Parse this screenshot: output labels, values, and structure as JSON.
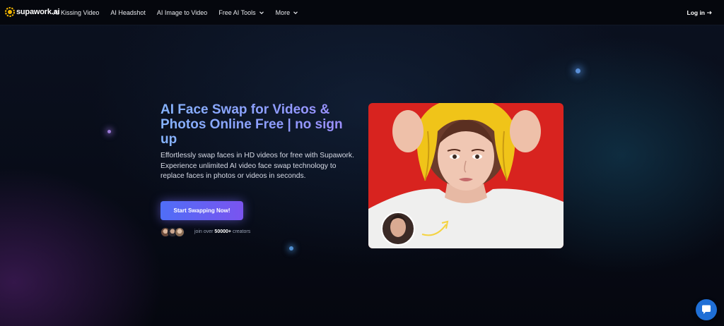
{
  "brand": {
    "name": "supawork.ai",
    "logo_icon": "gear-icon"
  },
  "nav": {
    "items": [
      {
        "label": "AI Kissing Video",
        "has_dropdown": false
      },
      {
        "label": "AI Headshot",
        "has_dropdown": false
      },
      {
        "label": "AI Image to Video",
        "has_dropdown": false
      },
      {
        "label": "Free AI Tools",
        "has_dropdown": true
      },
      {
        "label": "More",
        "has_dropdown": true
      }
    ],
    "login_label": "Log in"
  },
  "hero": {
    "title": "AI Face Swap for Videos & Photos Online Free | no sign up",
    "description": "Effortlessly swap faces in HD videos for free with Supawork. Experience unlimited AI video face swap technology to replace faces in photos or videos in seconds.",
    "cta_label": "Start Swapping Now!",
    "social_proof": {
      "prefix": "join over",
      "count": "50000+",
      "suffix": "creators"
    }
  },
  "colors": {
    "accent_gradient_start": "#4f6ef7",
    "accent_gradient_end": "#7a54ef",
    "title_color": "#86b4ff",
    "chat_button": "#1f6fd6",
    "photo_background": "#d8231f"
  },
  "chat": {
    "icon": "chat-bubble-icon"
  }
}
